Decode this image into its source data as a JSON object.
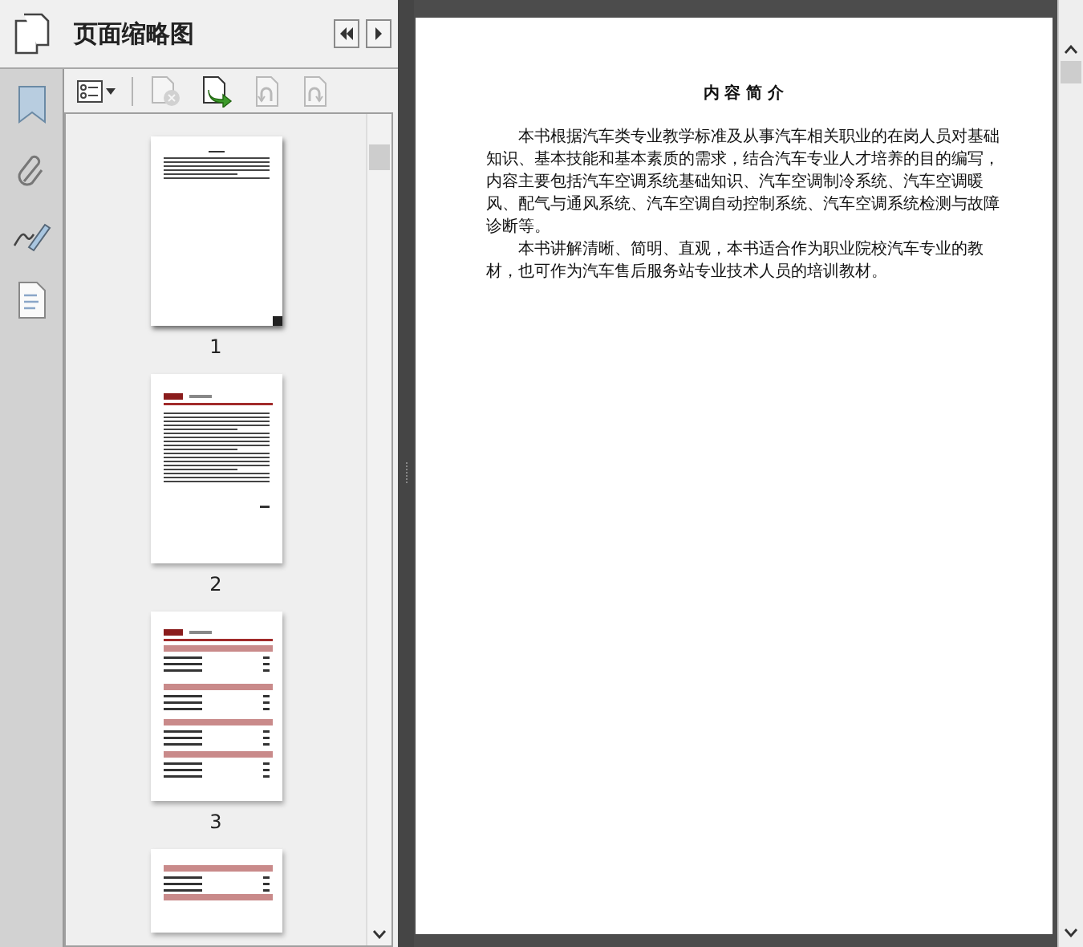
{
  "panel": {
    "title": "页面缩略图"
  },
  "toolbar": [
    {
      "kind": "options",
      "disabled": false
    },
    {
      "kind": "delete",
      "disabled": true
    },
    {
      "kind": "insert",
      "disabled": false
    },
    {
      "kind": "rotate-left",
      "disabled": true
    },
    {
      "kind": "rotate-right",
      "disabled": true
    }
  ],
  "thumbnails": [
    {
      "kind": "text-page",
      "label": "1",
      "current": true
    },
    {
      "kind": "preface",
      "label": "2",
      "current": false
    },
    {
      "kind": "contents",
      "label": "3",
      "current": false
    },
    {
      "kind": "contents-end",
      "current": false
    }
  ],
  "document": {
    "title": "内 容 简 介",
    "paragraphs": [
      "本书根据汽车类专业教学标准及从事汽车相关职业的在岗人员对基础知识、基本技能和基本素质的需求，结合汽车专业人才培养的目的编写，内容主要包括汽车空调系统基础知识、汽车空调制冷系统、汽车空调暖风、配气与通风系统、汽车空调自动控制系统、汽车空调系统检测与故障诊断等。",
      "本书讲解清晰、简明、直观，本书适合作为职业院校汽车专业的教材，也可作为汽车售后服务站专业技术人员的培训教材。"
    ]
  }
}
